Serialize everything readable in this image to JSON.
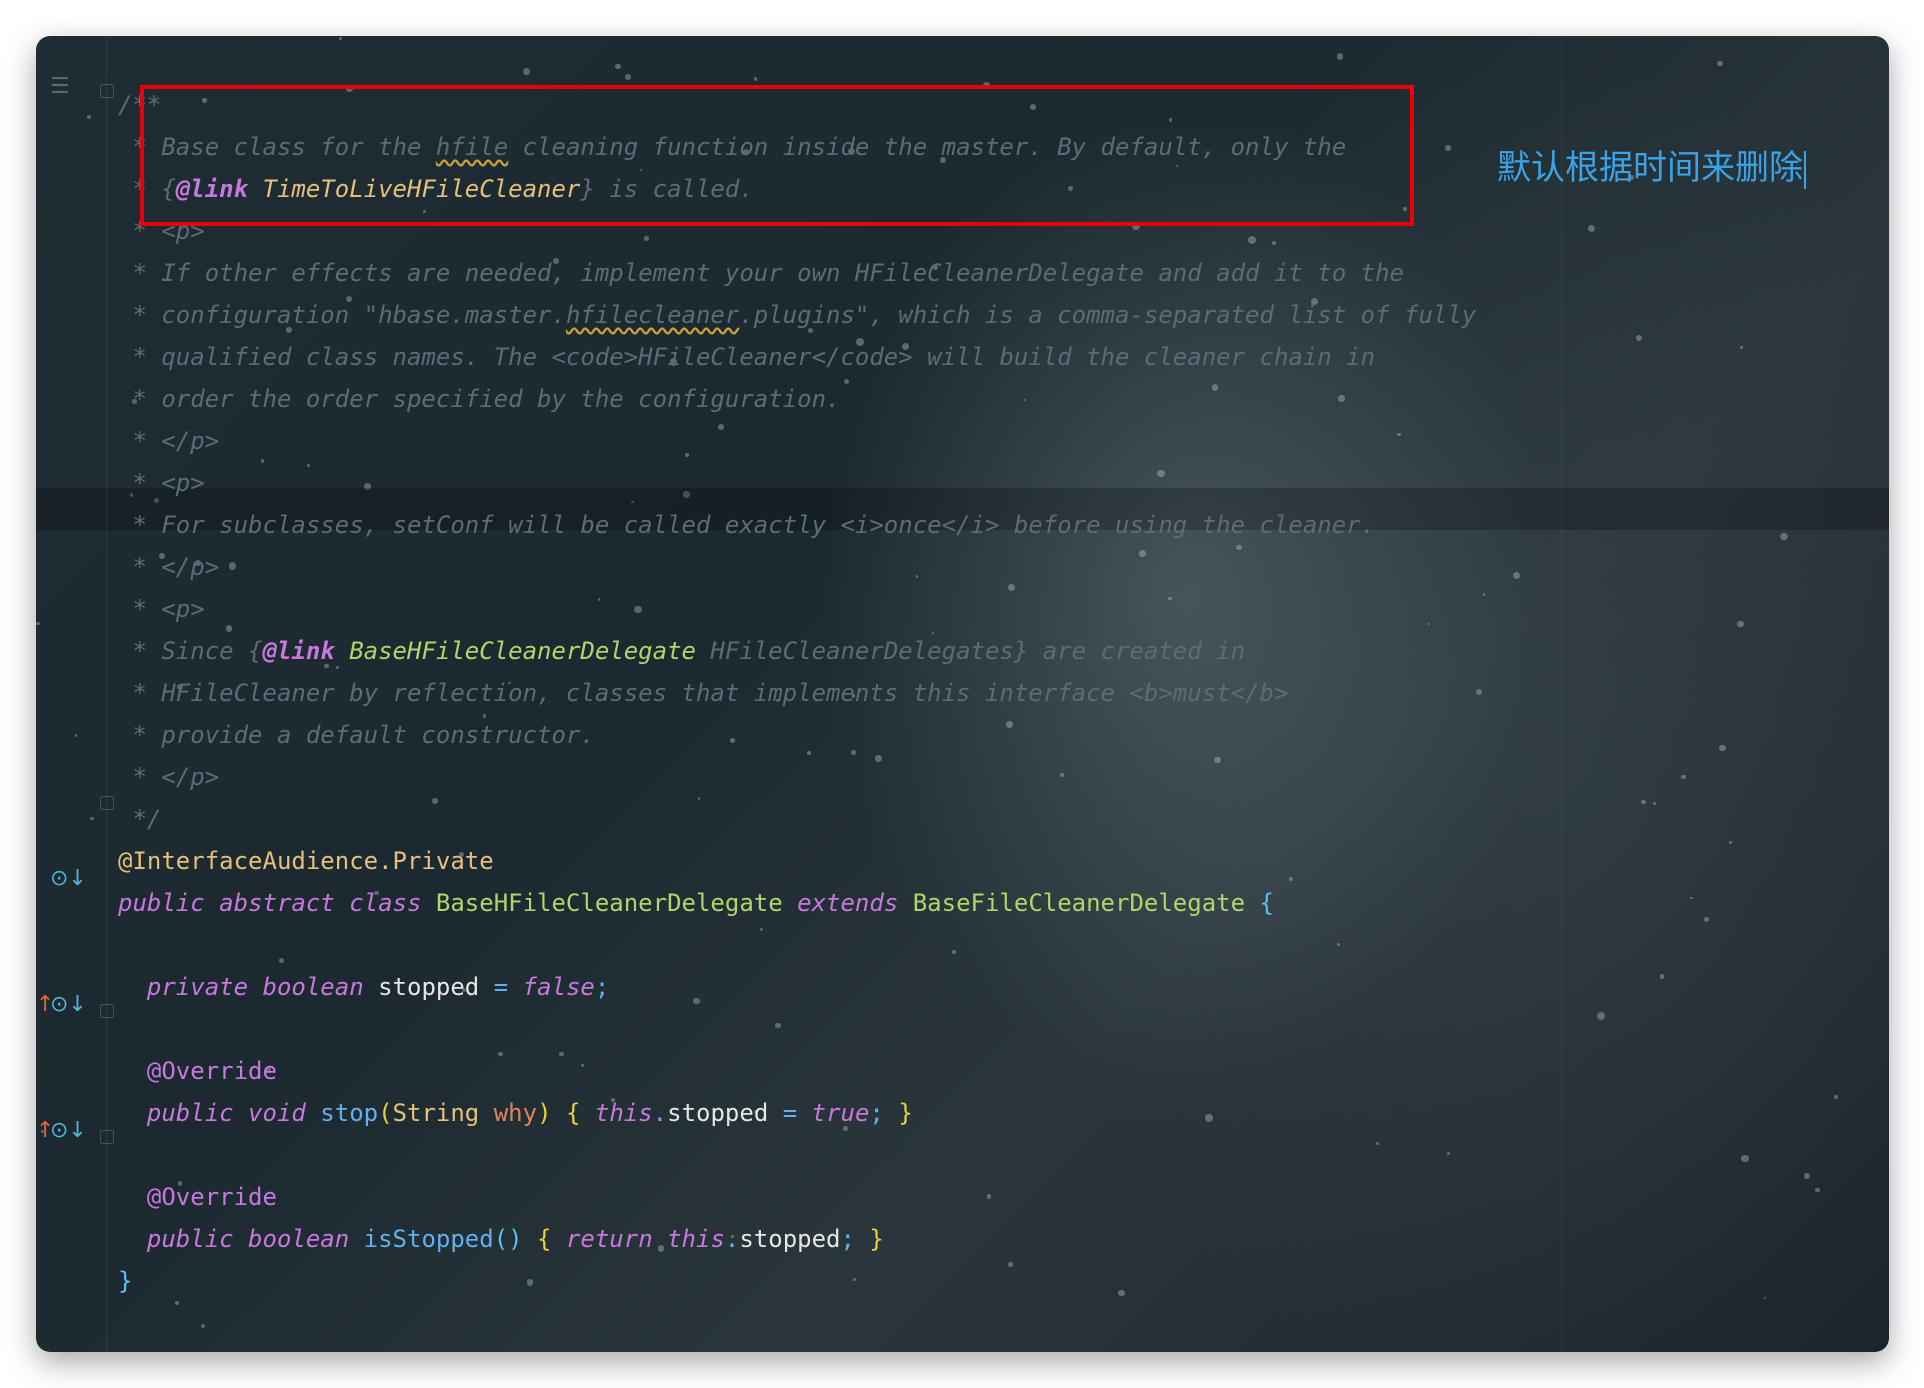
{
  "editor": {
    "lines": [
      [
        {
          "t": "/**",
          "c": "c-tag"
        }
      ],
      [
        {
          "t": " * Base class for the ",
          "c": "c-tag"
        },
        {
          "t": "hfile",
          "c": "c-tag squiggle"
        },
        {
          "t": " cleaning function inside the master. By default, only the",
          "c": "c-tag"
        }
      ],
      [
        {
          "t": " * {",
          "c": "c-tag"
        },
        {
          "t": "@link",
          "c": "c-link"
        },
        {
          "t": " TimeToLiveHFileCleaner",
          "c": "c-linkcls"
        },
        {
          "t": "} is called.",
          "c": "c-tag"
        }
      ],
      [
        {
          "t": " * <p>",
          "c": "c-tag"
        }
      ],
      [
        {
          "t": " * If other effects are needed, implement your own HFileCleanerDelegate and add it to the",
          "c": "c-tag"
        }
      ],
      [
        {
          "t": " * configuration \"hbase.master.",
          "c": "c-tag"
        },
        {
          "t": "hfilecleaner",
          "c": "c-tag squiggle"
        },
        {
          "t": ".plugins\", which is a comma-separated list of fully",
          "c": "c-tag"
        }
      ],
      [
        {
          "t": " * qualified class names. The <code>HFileCleaner</code> will build the cleaner chain in",
          "c": "c-tag"
        }
      ],
      [
        {
          "t": " * order the order specified by the configuration.",
          "c": "c-tag"
        }
      ],
      [
        {
          "t": " * </p>",
          "c": "c-tag"
        }
      ],
      [
        {
          "t": " * <p>",
          "c": "c-tag"
        }
      ],
      [
        {
          "t": " * For subclasses, setConf will be called exactly <i>once</i> before using the cleaner.",
          "c": "c-tag"
        }
      ],
      [
        {
          "t": " * </p>",
          "c": "c-tag"
        }
      ],
      [
        {
          "t": " * <p>",
          "c": "c-tag"
        }
      ],
      [
        {
          "t": " * Since {",
          "c": "c-tag"
        },
        {
          "t": "@link",
          "c": "c-link"
        },
        {
          "t": " BaseHFileCleanerDelegate",
          "c": "c-linkcls2"
        },
        {
          "t": " HFileCleanerDelegates} are created in",
          "c": "c-tag"
        }
      ],
      [
        {
          "t": " * HFileCleaner by reflection, classes that implements this interface <b>must</b>",
          "c": "c-tag"
        }
      ],
      [
        {
          "t": " * provide a default constructor.",
          "c": "c-tag"
        }
      ],
      [
        {
          "t": " * </p>",
          "c": "c-tag"
        }
      ],
      [
        {
          "t": " */",
          "c": "c-tag"
        }
      ],
      [
        {
          "t": "@InterfaceAudience.Private",
          "c": "code ann"
        }
      ],
      [
        {
          "t": "public abstract class ",
          "c": "k"
        },
        {
          "t": "BaseHFileCleanerDelegate ",
          "c": "code cls"
        },
        {
          "t": "extends ",
          "c": "k"
        },
        {
          "t": "BaseFileCleanerDelegate ",
          "c": "code cls"
        },
        {
          "t": "{",
          "c": "code brace2"
        }
      ],
      [],
      [
        {
          "t": "  private boolean ",
          "c": "k"
        },
        {
          "t": "stopped ",
          "c": "code var"
        },
        {
          "t": "= ",
          "c": "code op"
        },
        {
          "t": "false",
          "c": "k"
        },
        {
          "t": ";",
          "c": "code op"
        }
      ],
      [],
      [
        {
          "t": "  @Override",
          "c": "code ann2"
        }
      ],
      [
        {
          "t": "  public void ",
          "c": "k"
        },
        {
          "t": "stop",
          "c": "code fn"
        },
        {
          "t": "(",
          "c": "code brace"
        },
        {
          "t": "String ",
          "c": "code type"
        },
        {
          "t": "why",
          "c": "code param"
        },
        {
          "t": ") ",
          "c": "code brace"
        },
        {
          "t": "{ ",
          "c": "code brace"
        },
        {
          "t": "this",
          "c": "k"
        },
        {
          "t": ".",
          "c": "code op"
        },
        {
          "t": "stopped ",
          "c": "code var"
        },
        {
          "t": "= ",
          "c": "code op"
        },
        {
          "t": "true",
          "c": "k"
        },
        {
          "t": "; ",
          "c": "code op"
        },
        {
          "t": "}",
          "c": "code brace"
        }
      ],
      [],
      [
        {
          "t": "  @Override",
          "c": "code ann2"
        }
      ],
      [
        {
          "t": "  public boolean ",
          "c": "k"
        },
        {
          "t": "isStopped",
          "c": "code fn"
        },
        {
          "t": "() ",
          "c": "code brace2"
        },
        {
          "t": "{ ",
          "c": "code brace"
        },
        {
          "t": "return ",
          "c": "k"
        },
        {
          "t": "this",
          "c": "k"
        },
        {
          "t": ".",
          "c": "code op"
        },
        {
          "t": "stopped",
          "c": "code var"
        },
        {
          "t": "; ",
          "c": "code op"
        },
        {
          "t": "}",
          "c": "code brace"
        }
      ],
      [
        {
          "t": "}",
          "c": "code brace2"
        }
      ]
    ]
  },
  "annotation_note": "默认根据时间来删除",
  "colors": {
    "highlight_box": "#e8000b",
    "note_text": "#3aa3e6",
    "comment": "#5d6b74",
    "keyword": "#c678dd",
    "class_name": "#b5d36a"
  },
  "gutter_icons": {
    "structure": "structure-icon",
    "implemented": "implemented-icon",
    "override": "override-up-arrow-icon"
  }
}
